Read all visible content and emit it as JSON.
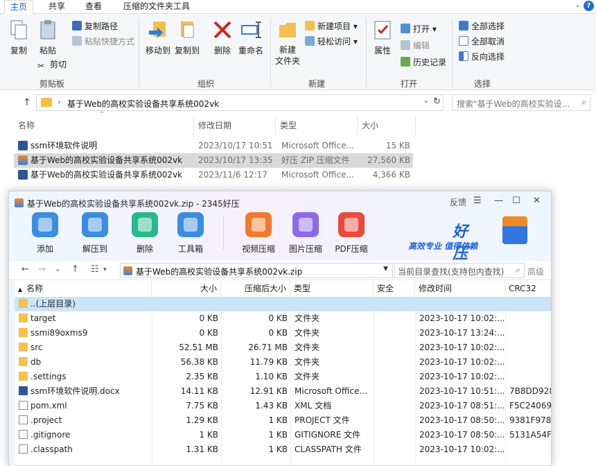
{
  "explorer": {
    "tabs": [
      "主页",
      "共享",
      "查看",
      "压缩的文件夹工具"
    ],
    "help": "?",
    "ribbon": {
      "clipboard": {
        "label": "剪贴板",
        "copy": "复制",
        "paste": "粘贴",
        "copy_path": "复制路径",
        "paste_shortcut": "粘贴快捷方式",
        "cut": "剪切"
      },
      "organize": {
        "label": "组织",
        "move_to": "移动到",
        "copy_to": "复制到",
        "delete": "删除",
        "rename": "重命名"
      },
      "new": {
        "label": "新建",
        "new_folder": "新建\n文件夹",
        "new_item": "新建项目",
        "easy_access": "轻松访问"
      },
      "open": {
        "label": "打开",
        "properties": "属性",
        "open": "打开",
        "edit": "编辑",
        "history": "历史记录"
      },
      "select": {
        "label": "选择",
        "select_all": "全部选择",
        "select_none": "全部取消",
        "invert": "反向选择"
      }
    },
    "address": "基于Web的高校实验设备共享系统002vk",
    "search_placeholder": "搜索\"基于Web的高校实验设...",
    "columns": [
      "名称",
      "修改日期",
      "类型",
      "大小"
    ],
    "files": [
      {
        "name": "ssm环境软件说明",
        "date": "2023/10/17 10:51",
        "type": "Microsoft Office...",
        "size": "15 KB",
        "icon": "word-doc-icon"
      },
      {
        "name": "基于Web的高校实验设备共享系统002vk",
        "date": "2023/10/17 13:35",
        "type": "好压 ZIP 压缩文件",
        "size": "27,560 KB",
        "icon": "zip-archive-icon",
        "selected": true
      },
      {
        "name": "基于Web的高校实验设备共享系统002vk",
        "date": "2023/11/6 12:17",
        "type": "Microsoft Office...",
        "size": "4,366 KB",
        "icon": "word-doc-icon"
      }
    ]
  },
  "haozip": {
    "title": "基于Web的高校实验设备共享系统002vk.zip - 2345好压",
    "feedback": "反馈",
    "toolbar": [
      {
        "label": "添加",
        "icon": "add-icon",
        "color": "#3b8de0"
      },
      {
        "label": "解压到",
        "icon": "extract-icon",
        "color": "#3b8de0"
      },
      {
        "label": "删除",
        "icon": "recycle-icon",
        "color": "#27b98a"
      },
      {
        "label": "工具箱",
        "icon": "toolbox-icon",
        "color": "#3b8de0"
      },
      {
        "label": "视频压缩",
        "icon": "video-compress-icon",
        "color": "#f07a2e"
      },
      {
        "label": "图片压缩",
        "icon": "image-compress-icon",
        "color": "#8b6be8"
      },
      {
        "label": "PDF压缩",
        "icon": "pdf-compress-icon",
        "color": "#e84a3c"
      }
    ],
    "brand_name": "好压",
    "brand_slogan": "高效专业  值得信赖",
    "path": "基于Web的高校实验设备共享系统002vk.zip",
    "search_placeholder": "当前目录查找(支持包内查找)",
    "advanced": "高级",
    "columns": [
      "名称",
      "大小",
      "压缩后大小",
      "类型",
      "安全",
      "修改时间",
      "CRC32"
    ],
    "rows": [
      {
        "name": "..(上层目录)",
        "size": "",
        "packed": "",
        "type": "",
        "time": "",
        "crc": "",
        "icon": "folder"
      },
      {
        "name": "target",
        "size": "0 KB",
        "packed": "0 KB",
        "type": "文件夹",
        "time": "2023-10-17 10:02:...",
        "crc": "",
        "icon": "folder"
      },
      {
        "name": "ssmi89oxms9",
        "size": "0 KB",
        "packed": "0 KB",
        "type": "文件夹",
        "time": "2023-10-17 13:24:...",
        "crc": "",
        "icon": "folder"
      },
      {
        "name": "src",
        "size": "52.51 MB",
        "packed": "26.71 MB",
        "type": "文件夹",
        "time": "2023-10-17 10:02:...",
        "crc": "",
        "icon": "folder"
      },
      {
        "name": "db",
        "size": "56.38 KB",
        "packed": "11.79 KB",
        "type": "文件夹",
        "time": "2023-10-17 10:02:...",
        "crc": "",
        "icon": "folder"
      },
      {
        "name": ".settings",
        "size": "2.35 KB",
        "packed": "1.10 KB",
        "type": "文件夹",
        "time": "2023-10-17 10:02:...",
        "crc": "",
        "icon": "folder"
      },
      {
        "name": "ssm环境软件说明.docx",
        "size": "14.11 KB",
        "packed": "12.91 KB",
        "type": "Microsoft Office...",
        "time": "2023-10-17 10:51:...",
        "crc": "7B8DD928",
        "icon": "doc"
      },
      {
        "name": "pom.xml",
        "size": "7.75 KB",
        "packed": "1.43 KB",
        "type": "XML 文档",
        "time": "2023-10-17 08:51:...",
        "crc": "F5C24069",
        "icon": "file"
      },
      {
        "name": ".project",
        "size": "1.29 KB",
        "packed": "1 KB",
        "type": "PROJECT 文件",
        "time": "2023-10-17 08:50:...",
        "crc": "9381F978",
        "icon": "file"
      },
      {
        "name": ".gitignore",
        "size": "1 KB",
        "packed": "1 KB",
        "type": "GITIGNORE 文件",
        "time": "2023-10-17 08:50:...",
        "crc": "5131A54F",
        "icon": "file"
      },
      {
        "name": ".classpath",
        "size": "1.31 KB",
        "packed": "1 KB",
        "type": "CLASSPATH 文件",
        "time": "2023-10-17 10:02:...",
        "crc": "",
        "icon": "file"
      }
    ]
  }
}
